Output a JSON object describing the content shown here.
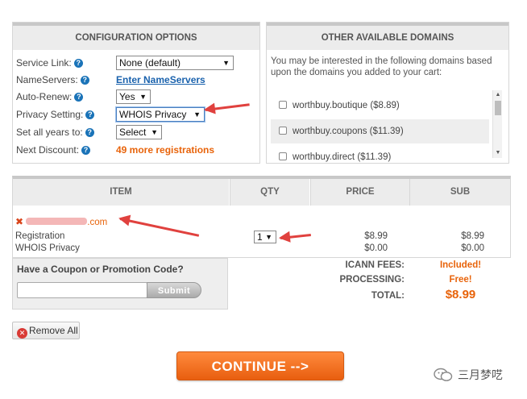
{
  "config": {
    "title": "CONFIGURATION OPTIONS",
    "service_link": {
      "label": "Service Link:",
      "value": "None (default)"
    },
    "nameservers": {
      "label": "NameServers:",
      "link": "Enter NameServers"
    },
    "auto_renew": {
      "label": "Auto-Renew:",
      "value": "Yes"
    },
    "privacy": {
      "label": "Privacy Setting:",
      "value": "WHOIS Privacy"
    },
    "all_years": {
      "label": "Set all years to:",
      "value": "Select"
    },
    "next_discount": {
      "label": "Next Discount:",
      "value": "49 more registrations"
    }
  },
  "domains": {
    "title": "OTHER AVAILABLE DOMAINS",
    "intro": "You may be interested in the following domains based upon the domains you added to your cart:",
    "items": [
      {
        "label": "worthbuy.boutique ($8.89)"
      },
      {
        "label": "worthbuy.coupons ($11.39)"
      },
      {
        "label": "worthbuy.direct ($11.39)"
      }
    ]
  },
  "cart": {
    "headers": {
      "item": "ITEM",
      "qty": "QTY",
      "price": "PRICE",
      "sub": "SUB"
    },
    "domain_suffix": ".com",
    "lines": [
      {
        "name": "Registration",
        "price": "$8.99",
        "sub": "$8.99"
      },
      {
        "name": "WHOIS Privacy",
        "price": "$0.00",
        "sub": "$0.00"
      }
    ],
    "qty": "1"
  },
  "coupon": {
    "title": "Have a Coupon or Promotion Code?",
    "placeholder": "",
    "submit": "Submit"
  },
  "totals": {
    "icann_label": "ICANN FEES:",
    "icann_value": "Included!",
    "processing_label": "PROCESSING:",
    "processing_value": "Free!",
    "total_label": "TOTAL:",
    "total_value": "$8.99"
  },
  "actions": {
    "remove_all": "Remove All",
    "continue": "CONTINUE -->"
  },
  "watermark": {
    "text": "三月梦呓"
  },
  "colors": {
    "accent": "#e8630a",
    "link": "#1a62ad",
    "arrow": "#e0413e",
    "continue": "#f06a17"
  }
}
